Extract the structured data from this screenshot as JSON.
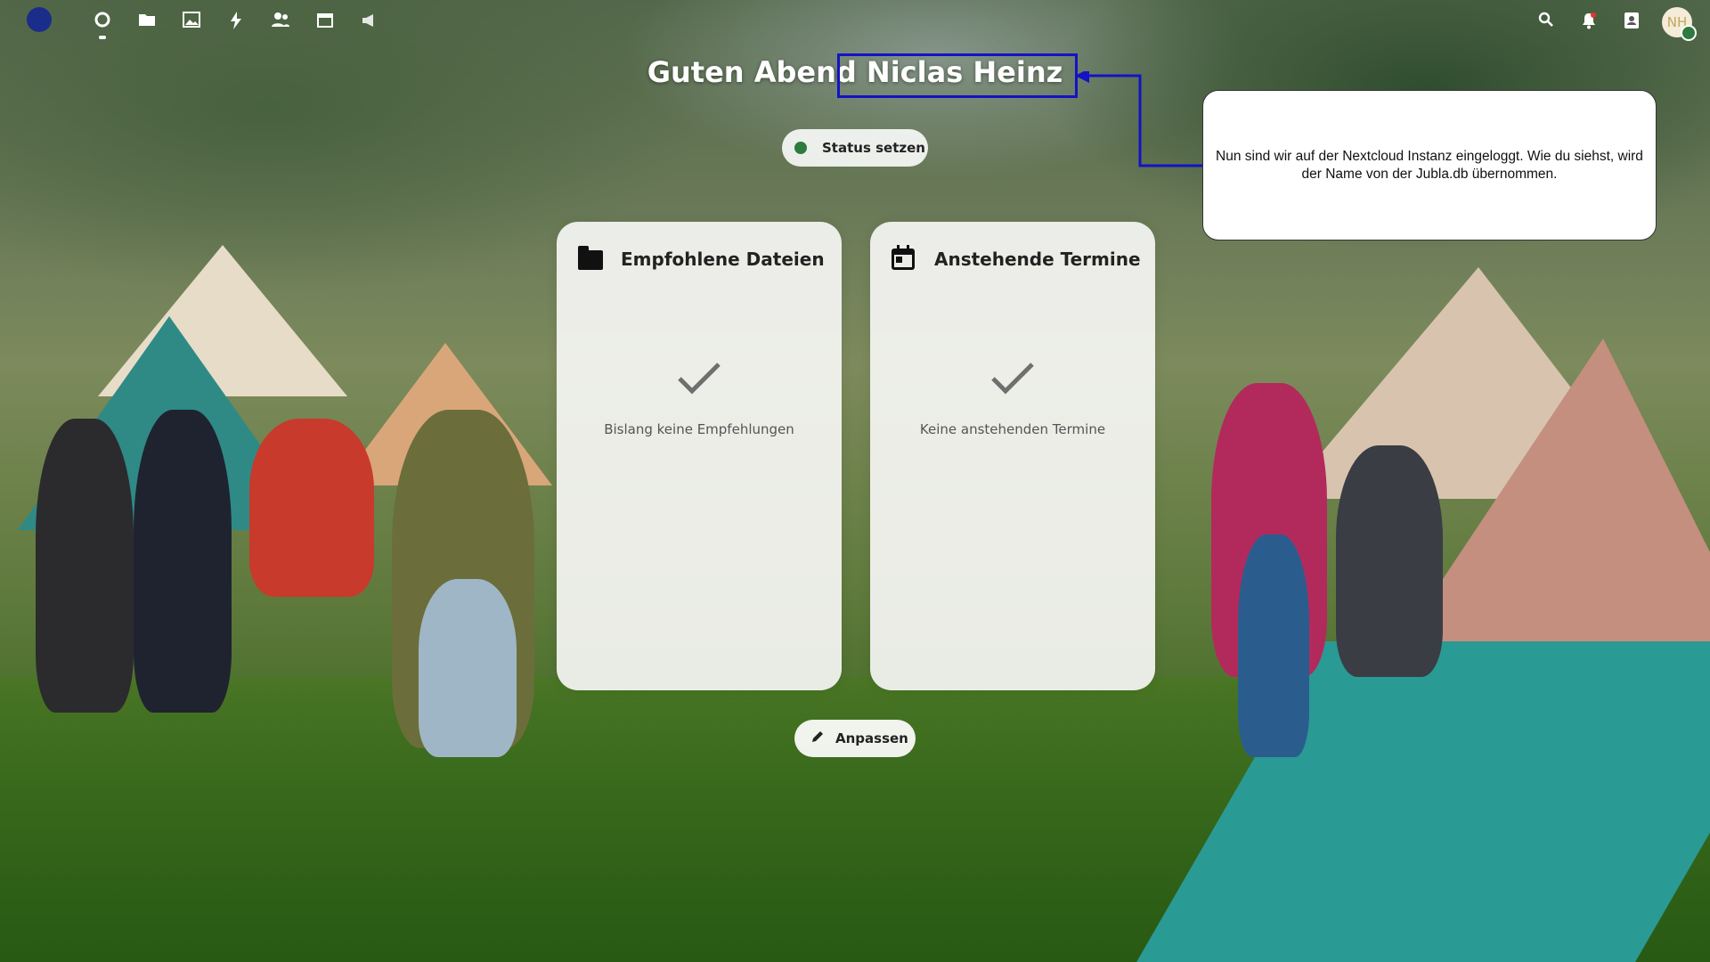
{
  "topbar": {
    "apps": [
      {
        "name": "dashboard",
        "icon": "dashboard-icon",
        "active": true
      },
      {
        "name": "files",
        "icon": "folder-icon"
      },
      {
        "name": "photos",
        "icon": "image-icon"
      },
      {
        "name": "activity",
        "icon": "lightning-icon"
      },
      {
        "name": "contacts",
        "icon": "contacts-icon"
      },
      {
        "name": "calendar",
        "icon": "calendar-icon"
      },
      {
        "name": "announcements",
        "icon": "megaphone-icon"
      }
    ],
    "right_icons": [
      "search-icon",
      "bell-icon",
      "contacts-menu-icon"
    ],
    "avatar_initials": "NH",
    "notification_accent": "#e9322d"
  },
  "greeting": "Guten Abend Niclas Heinz",
  "status": {
    "label": "Status setzen",
    "color": "#2d7b3f"
  },
  "panels": {
    "files": {
      "title": "Empfohlene Dateien",
      "empty": "Bislang keine Empfehlungen"
    },
    "events": {
      "title": "Anstehende Termine",
      "empty": "Keine anstehenden Termine"
    }
  },
  "customize": {
    "label": "Anpassen"
  },
  "annotation": {
    "text": "Nun sind wir auf der Nextcloud Instanz eingeloggt. Wie du siehst, wird der Name von der Jubla.db übernommen.",
    "color": "#1313c4"
  }
}
